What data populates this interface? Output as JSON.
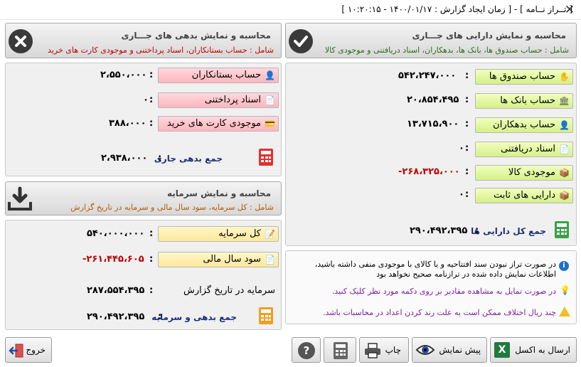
{
  "window": {
    "title": "[ تــراز نــامه ] - [ زمان ایجاد گزارش : ۱۴۰۰/۰۱/۱۷ - ۱۰:۲۰:۱۵ ]"
  },
  "assets": {
    "title": "محاسبه و نمایش دارایی های جـــاری",
    "subtitle": "شامل : حساب صندوق ها، بانک ها، بدهکاران، اسناد دریافتنی و موجودی کالا",
    "rows": [
      {
        "label": "حساب صندوق ها",
        "value": "۵۴۲،۲۴۷،۰۰۰"
      },
      {
        "label": "حساب بانک ها",
        "value": "۲۰،۸۵۴،۴۹۵"
      },
      {
        "label": "حساب بدهکاران",
        "value": "۱۳،۷۱۵،۹۰۰"
      },
      {
        "label": "اسناد دریافتنی",
        "value": "۰"
      },
      {
        "label": "موجودی کالا",
        "value": "-۲۶۸،۳۲۵،۰۰۰"
      },
      {
        "label": "دارایی های ثابت",
        "value": "۰"
      }
    ],
    "total_label": "جمع کل دارایی ها",
    "total_value": "۲۹۰،۴۹۲،۳۹۵"
  },
  "liabilities": {
    "title": "محاسبه و نمایش بدهی های جـــاری",
    "subtitle": "شامل : حساب بستانکاران، اسناد پرداختنی و موجودی کارت های خرید",
    "rows": [
      {
        "label": "حساب بستانکاران",
        "value": "۲،۵۵۰،۰۰۰"
      },
      {
        "label": "اسناد پرداختنی",
        "value": "۰"
      },
      {
        "label": "موجودی کارت های خرید",
        "value": "۳۸۸،۰۰۰"
      }
    ],
    "total_label": "جمع بدهی جاری",
    "total_value": "۲،۹۳۸،۰۰۰"
  },
  "capital": {
    "title": "محاسبه و نمایش سرمایه",
    "subtitle": "شامل : کل سرمایه، سود سال مالی و سرمایه در تاریخ گزارش",
    "rows": [
      {
        "label": "کل سرمایه",
        "value": "۵۴۰،۰۰۰،۰۰۰"
      },
      {
        "label": "سود سال مالی",
        "value": "-۲۶۱،۴۴۵،۶۰۵"
      }
    ],
    "date_label": "سرمایه در تاریخ گزارش",
    "date_value": "۲۸۷،۵۵۴،۳۹۵",
    "total_label": "جمع بدهی و سرمایه",
    "total_value": "۲۹۰،۴۹۲،۳۹۵"
  },
  "notes": {
    "info": "در صورت تراز نبودن سند افتتاحیه و یا کالای با موجودی منفی داشته باشید، اطلاعات نمایش داده شده در ترازنامه صحیح نخواهد بود",
    "tip": "در صورت تمایل به مشاهده مقادیر بر روی دکمه مورد نظر کلیک کنید.",
    "warn": "چند ریال اختلاف ممکن است به علت رند کردن اعداد در محاسبات باشد."
  },
  "toolbar": {
    "excel": "ارسال به اکسل",
    "preview": "پیش نمایش",
    "print": "چاپ",
    "exit": "خروج"
  },
  "colors": {
    "negative": "#c00000",
    "total_label": "#1f2e7a",
    "subtitle_assets": "#2e6b1a",
    "subtitle_liab": "#c00000",
    "subtitle_capital": "#b85c00",
    "calc_red": "#e03030",
    "calc_green": "#3aa04a",
    "calc_orange": "#f0a020"
  }
}
